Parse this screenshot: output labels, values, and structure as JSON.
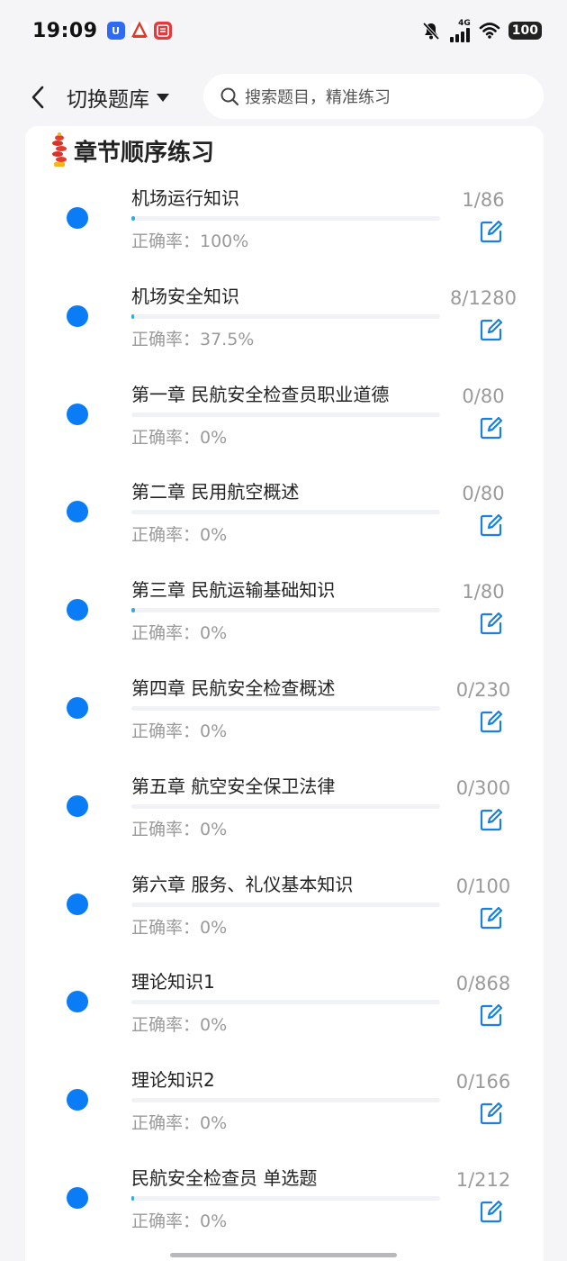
{
  "status_bar": {
    "time": "19:09",
    "network": "4G",
    "battery": "100"
  },
  "header": {
    "switch_label": "切换题库",
    "search_placeholder": "搜索题目，精准练习"
  },
  "section": {
    "title": "章节顺序练习"
  },
  "chapters": [
    {
      "title": "机场运行知识",
      "accuracy": "正确率：100%",
      "count": "1/86",
      "progress": 0.0116
    },
    {
      "title": "机场安全知识",
      "accuracy": "正确率：37.5%",
      "count": "8/1280",
      "progress": 0.00625
    },
    {
      "title": "第一章 民航安全检查员职业道德",
      "accuracy": "正确率：0%",
      "count": "0/80",
      "progress": 0
    },
    {
      "title": "第二章 民用航空概述",
      "accuracy": "正确率：0%",
      "count": "0/80",
      "progress": 0
    },
    {
      "title": "第三章 民航运输基础知识",
      "accuracy": "正确率：0%",
      "count": "1/80",
      "progress": 0.0125
    },
    {
      "title": "第四章 民航安全检查概述",
      "accuracy": "正确率：0%",
      "count": "0/230",
      "progress": 0
    },
    {
      "title": "第五章 航空安全保卫法律",
      "accuracy": "正确率：0%",
      "count": "0/300",
      "progress": 0
    },
    {
      "title": "第六章 服务、礼仪基本知识",
      "accuracy": "正确率：0%",
      "count": "0/100",
      "progress": 0
    },
    {
      "title": "理论知识1",
      "accuracy": "正确率：0%",
      "count": "0/868",
      "progress": 0
    },
    {
      "title": "理论知识2",
      "accuracy": "正确率：0%",
      "count": "0/166",
      "progress": 0
    },
    {
      "title": "民航安全检查员 单选题",
      "accuracy": "正确率：0%",
      "count": "1/212",
      "progress": 0.0047
    }
  ],
  "colors": {
    "accent": "#0a7cf5",
    "progress": "#39a9d9",
    "muted_text": "#9a9a9a"
  }
}
